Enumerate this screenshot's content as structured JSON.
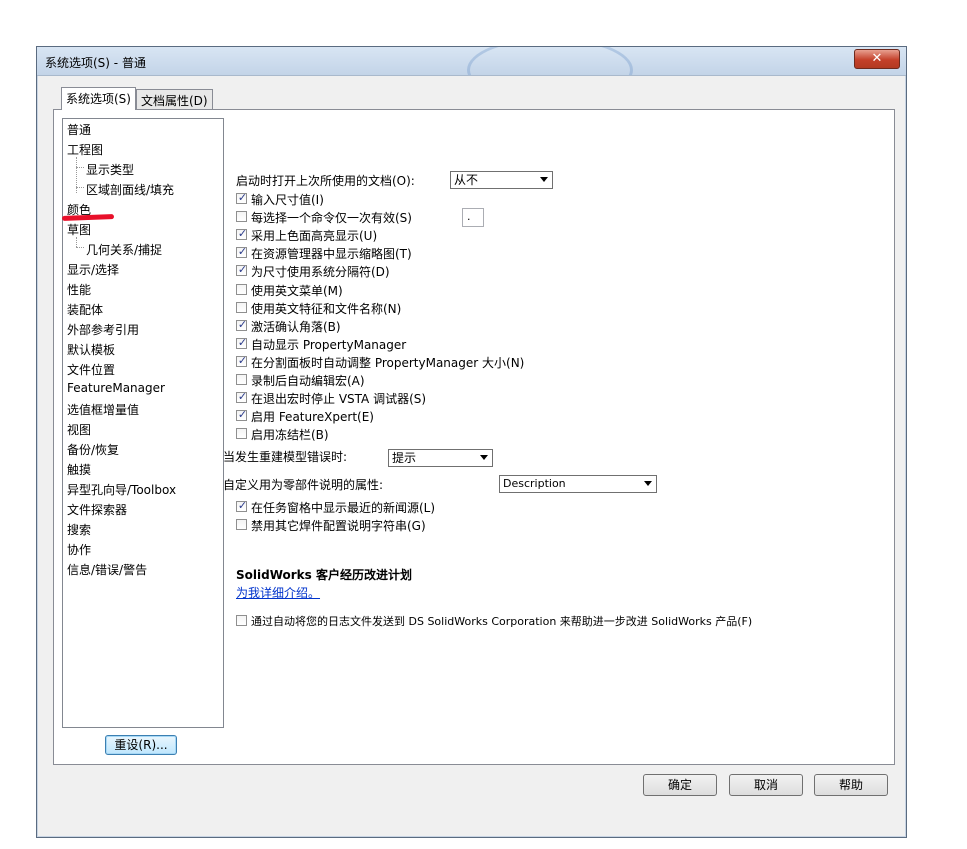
{
  "window": {
    "title": "系统选项(S) - 普通",
    "close_glyph": "✕"
  },
  "tabs": [
    {
      "label": "系统选项(S)",
      "active": true
    },
    {
      "label": "文档属性(D)",
      "active": false
    }
  ],
  "tree": [
    {
      "label": "普通",
      "level": 0
    },
    {
      "label": "工程图",
      "level": 0
    },
    {
      "label": "显示类型",
      "level": 1
    },
    {
      "label": "区域剖面线/填充",
      "level": 1
    },
    {
      "label": "颜色",
      "level": 0
    },
    {
      "label": "草图",
      "level": 0
    },
    {
      "label": "几何关系/捕捉",
      "level": 1
    },
    {
      "label": "显示/选择",
      "level": 0
    },
    {
      "label": "性能",
      "level": 0
    },
    {
      "label": "装配体",
      "level": 0
    },
    {
      "label": "外部参考引用",
      "level": 0
    },
    {
      "label": "默认模板",
      "level": 0
    },
    {
      "label": "文件位置",
      "level": 0
    },
    {
      "label": "FeatureManager",
      "level": 0
    },
    {
      "label": "选值框增量值",
      "level": 0
    },
    {
      "label": "视图",
      "level": 0
    },
    {
      "label": "备份/恢复",
      "level": 0
    },
    {
      "label": "触摸",
      "level": 0
    },
    {
      "label": "异型孔向导/Toolbox",
      "level": 0
    },
    {
      "label": "文件探索器",
      "level": 0
    },
    {
      "label": "搜索",
      "level": 0
    },
    {
      "label": "协作",
      "level": 0
    },
    {
      "label": "信息/错误/警告",
      "level": 0
    }
  ],
  "reset_button": "重设(R)...",
  "open_last_doc": {
    "label": "启动时打开上次所使用的文档(O):",
    "value": "从不"
  },
  "checkboxes": [
    {
      "label": "输入尺寸值(I)",
      "checked": true
    },
    {
      "label": "每选择一个命令仅一次有效(S)",
      "checked": false
    },
    {
      "label": "采用上色面高亮显示(U)",
      "checked": true
    },
    {
      "label": "在资源管理器中显示缩略图(T)",
      "checked": true
    },
    {
      "label": "为尺寸使用系统分隔符(D)",
      "checked": true
    },
    {
      "label": "使用英文菜单(M)",
      "checked": false
    },
    {
      "label": "使用英文特征和文件名称(N)",
      "checked": false
    },
    {
      "label": "激活确认角落(B)",
      "checked": true
    },
    {
      "label": "自动显示 PropertyManager",
      "checked": true
    },
    {
      "label": "在分割面板时自动调整 PropertyManager 大小(N)",
      "checked": true
    },
    {
      "label": "录制后自动编辑宏(A)",
      "checked": false
    },
    {
      "label": "在退出宏时停止 VSTA 调试器(S)",
      "checked": true
    },
    {
      "label": "启用 FeatureXpert(E)",
      "checked": true
    },
    {
      "label": "启用冻结栏(B)",
      "checked": false
    }
  ],
  "separator_value": ".",
  "rebuild_error": {
    "label": "当发生重建模型错误时:",
    "value": "提示"
  },
  "custom_prop": {
    "label": "自定义用为零部件说明的属性:",
    "value": "Description"
  },
  "checkboxes2": [
    {
      "label": "在任务窗格中显示最近的新闻源(L)",
      "checked": true
    },
    {
      "label": "禁用其它焊件配置说明字符串(G)",
      "checked": false
    }
  ],
  "ceip": {
    "heading": "SolidWorks 客户经历改进计划",
    "link": "为我详细介绍。",
    "opt_label": "通过自动将您的日志文件发送到 DS SolidWorks Corporation 来帮助进一步改进 SolidWorks 产品(F)",
    "opt_checked": false
  },
  "buttons": {
    "ok": "确定",
    "cancel": "取消",
    "help": "帮助"
  },
  "colors": {
    "annotation_mark": "#e8102a",
    "link": "#0033cc"
  }
}
